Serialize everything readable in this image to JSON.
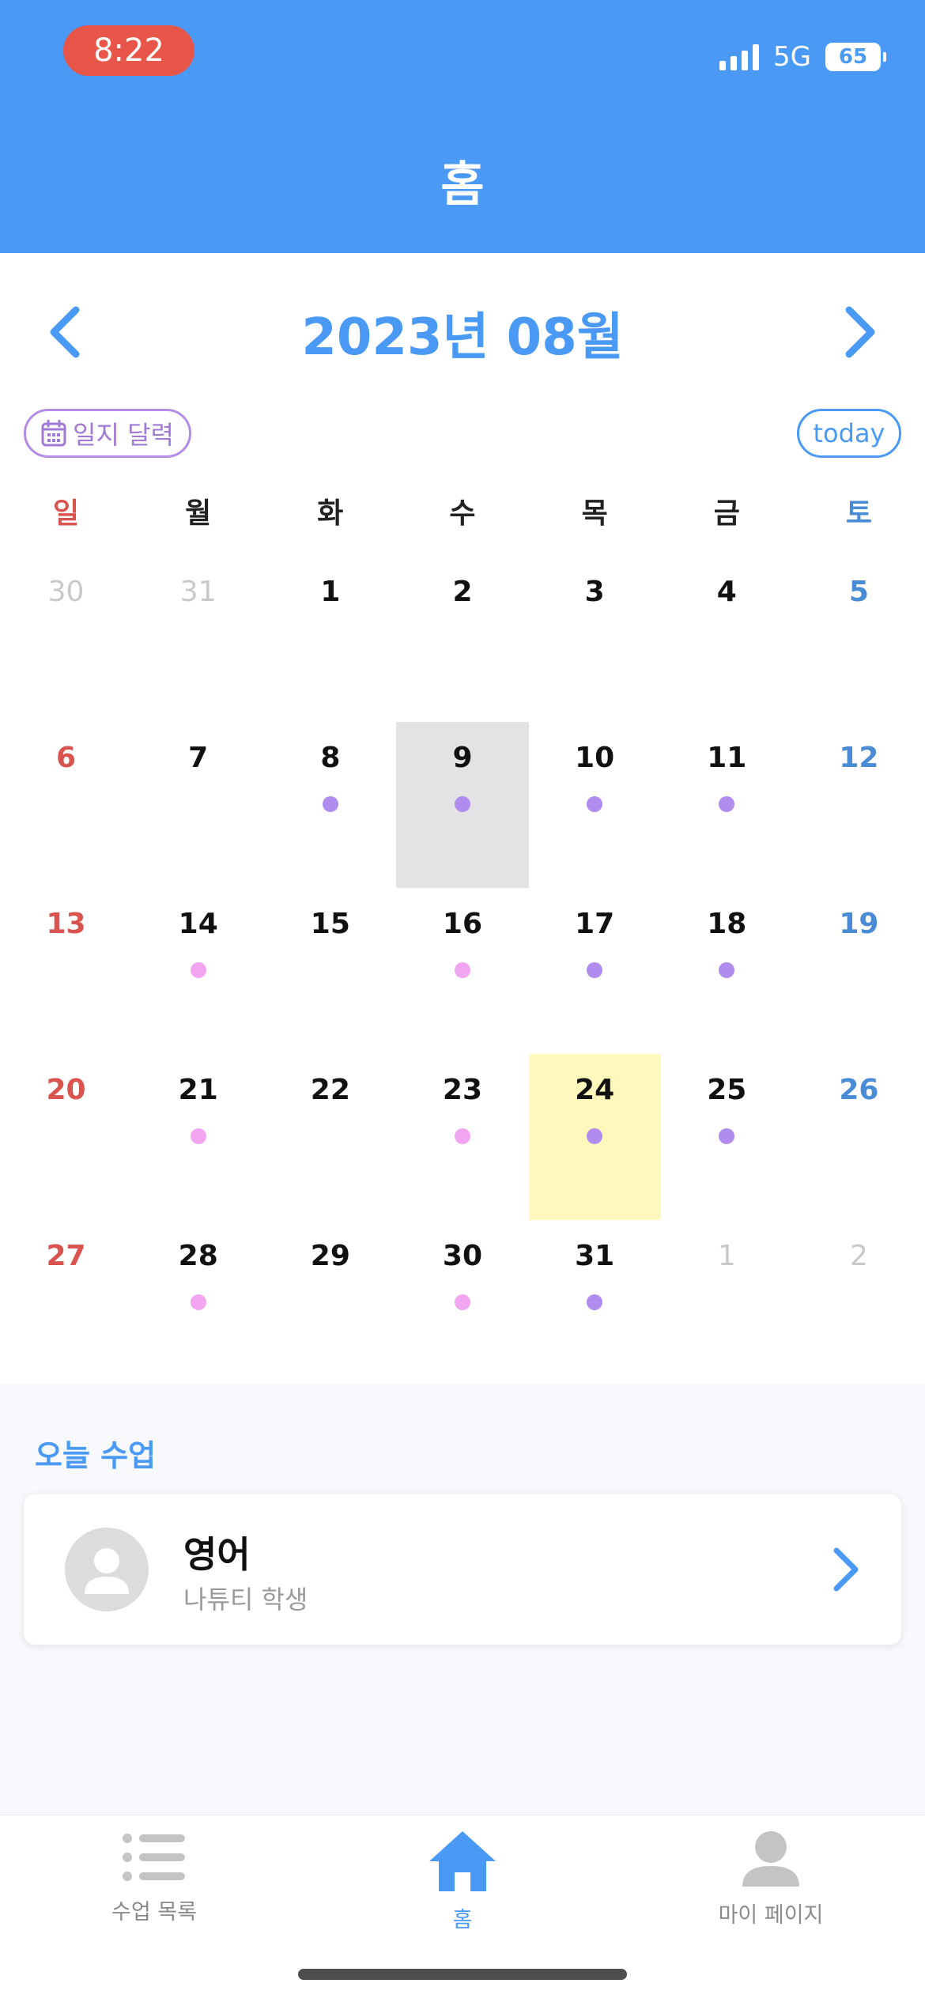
{
  "status": {
    "time": "8:22",
    "network": "5G",
    "battery": "65"
  },
  "header": {
    "title": "홈"
  },
  "calendar": {
    "month_title": "2023년 08월",
    "journal_button": "일지 달력",
    "today_button": "today",
    "weekdays": [
      "일",
      "월",
      "화",
      "수",
      "목",
      "금",
      "토"
    ],
    "dot_colors": {
      "purple": "#b08cef",
      "pink": "#f2a6f2"
    },
    "highlight_colors": {
      "selected": "#e3e3e6",
      "today": "#fff8bd"
    },
    "weeks": [
      [
        {
          "label": "30",
          "muted": true
        },
        {
          "label": "31",
          "muted": true
        },
        {
          "label": "1"
        },
        {
          "label": "2"
        },
        {
          "label": "3"
        },
        {
          "label": "4"
        },
        {
          "label": "5"
        }
      ],
      [
        {
          "label": "6"
        },
        {
          "label": "7"
        },
        {
          "label": "8",
          "dot": "purple"
        },
        {
          "label": "9",
          "dot": "purple",
          "selected": true
        },
        {
          "label": "10",
          "dot": "purple"
        },
        {
          "label": "11",
          "dot": "purple"
        },
        {
          "label": "12"
        }
      ],
      [
        {
          "label": "13"
        },
        {
          "label": "14",
          "dot": "pink"
        },
        {
          "label": "15"
        },
        {
          "label": "16",
          "dot": "pink"
        },
        {
          "label": "17",
          "dot": "purple"
        },
        {
          "label": "18",
          "dot": "purple"
        },
        {
          "label": "19"
        }
      ],
      [
        {
          "label": "20"
        },
        {
          "label": "21",
          "dot": "pink"
        },
        {
          "label": "22"
        },
        {
          "label": "23",
          "dot": "pink"
        },
        {
          "label": "24",
          "dot": "purple",
          "today": true
        },
        {
          "label": "25",
          "dot": "purple"
        },
        {
          "label": "26"
        }
      ],
      [
        {
          "label": "27"
        },
        {
          "label": "28",
          "dot": "pink"
        },
        {
          "label": "29"
        },
        {
          "label": "30",
          "dot": "pink"
        },
        {
          "label": "31",
          "dot": "purple"
        },
        {
          "label": "1",
          "muted": true
        },
        {
          "label": "2",
          "muted": true
        }
      ]
    ]
  },
  "today_classes": {
    "title": "오늘 수업",
    "items": [
      {
        "subject": "영어",
        "student": "나튜티 학생",
        "icon": "avatar-icon"
      }
    ]
  },
  "tab_bar": {
    "items": [
      {
        "label": "수업 목록",
        "icon": "list-icon"
      },
      {
        "label": "홈",
        "icon": "home-icon",
        "active": true
      },
      {
        "label": "마이 페이지",
        "icon": "person-icon"
      }
    ],
    "active_color": "#4a9af5",
    "inactive_color": "#c4c4c4"
  },
  "theme": {
    "primary": "#4a9af5",
    "status_pill": "#e8564a",
    "sunday": "#d9534f",
    "saturday": "#4a8bd6"
  }
}
